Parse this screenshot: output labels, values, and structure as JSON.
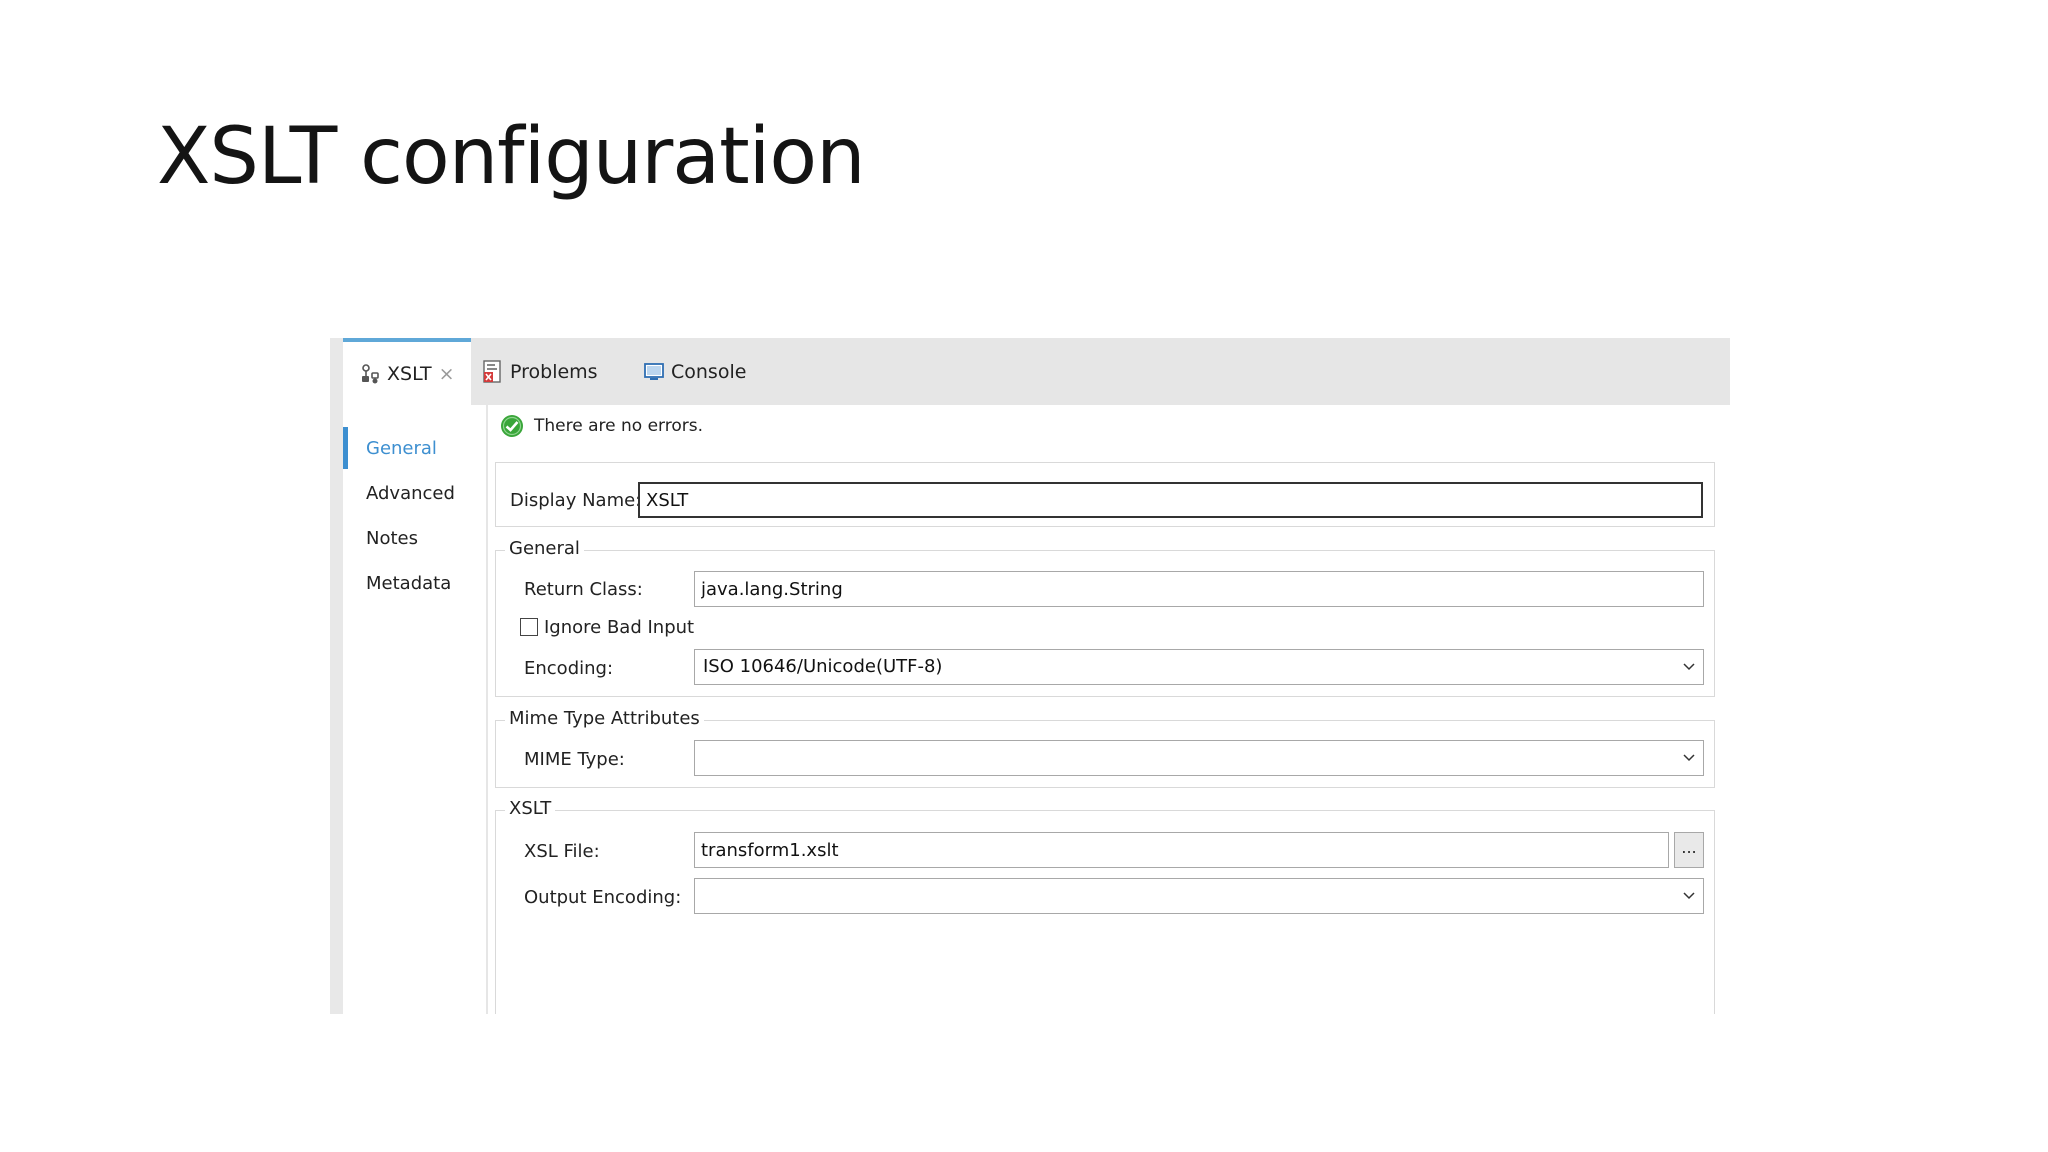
{
  "slide": {
    "title": "XSLT configuration"
  },
  "tabs": [
    {
      "label": "XSLT",
      "icon": "xslt-component-icon",
      "close": "×"
    },
    {
      "label": "Problems",
      "icon": "problems-icon"
    },
    {
      "label": "Console",
      "icon": "console-icon"
    }
  ],
  "sidenav": {
    "items": [
      "General",
      "Advanced",
      "Notes",
      "Metadata"
    ],
    "selected": "General"
  },
  "status": {
    "text": "There are no errors.",
    "icon": "check-circle-icon",
    "color": "#3aa63a"
  },
  "display": {
    "label": "Display Name:",
    "value": "XSLT"
  },
  "general": {
    "legend": "General",
    "return_class_label": "Return Class:",
    "return_class_value": "java.lang.String",
    "ignore_bad_input_label": "Ignore Bad Input",
    "ignore_bad_input_checked": false,
    "encoding_label": "Encoding:",
    "encoding_value": "ISO 10646/Unicode(UTF-8)"
  },
  "mime": {
    "legend": "Mime Type Attributes",
    "mime_type_label": "MIME Type:",
    "mime_type_value": ""
  },
  "xslt": {
    "legend": "XSLT",
    "xsl_file_label": "XSL File:",
    "xsl_file_value": "transform1.xslt",
    "browse_label": "...",
    "output_encoding_label": "Output Encoding:",
    "output_encoding_value": ""
  },
  "colors": {
    "accent": "#3d8fd0",
    "tab_accent": "#5fa8d8",
    "tabbar": "#e6e6e6"
  }
}
